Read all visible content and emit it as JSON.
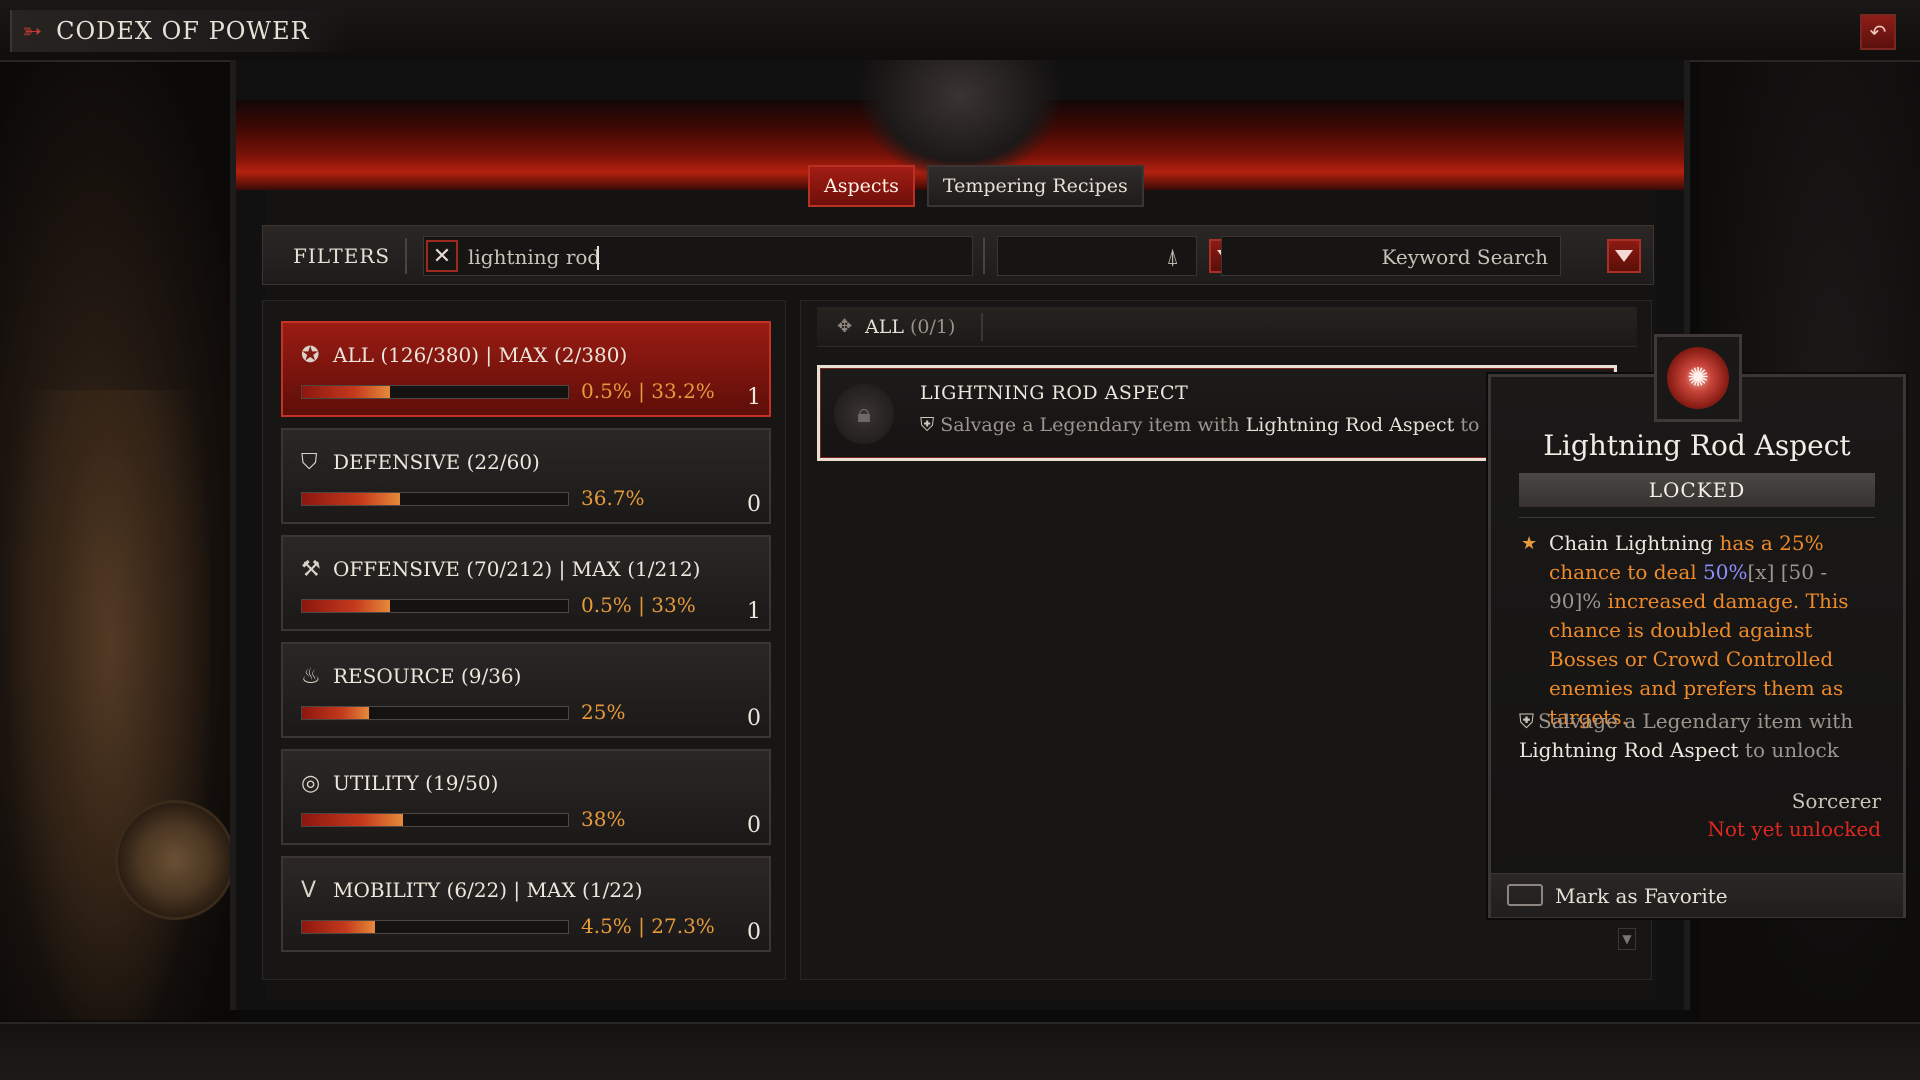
{
  "header": {
    "title": "CODEX OF POWER",
    "back_icon": "return-arrow-icon"
  },
  "tabs": [
    {
      "label": "Aspects",
      "active": true
    },
    {
      "label": "Tempering Recipes",
      "active": false
    }
  ],
  "filters": {
    "label": "FILTERS",
    "search_value": "lightning rod",
    "keyword_placeholder": "Keyword Search"
  },
  "categories": [
    {
      "icon": "star-icon",
      "label": "ALL (126/380) | MAX (2/380)",
      "pct_text": "0.5% | 33.2%",
      "count": "1",
      "progress": 0.33,
      "active": true
    },
    {
      "icon": "shield-icon",
      "label": "DEFENSIVE (22/60)",
      "pct_text": "36.7%",
      "count": "0",
      "progress": 0.367,
      "active": false
    },
    {
      "icon": "axe-icon",
      "label": "OFFENSIVE (70/212) | MAX (1/212)",
      "pct_text": "0.5% | 33%",
      "count": "1",
      "progress": 0.33,
      "active": false
    },
    {
      "icon": "flame-icon",
      "label": "RESOURCE (9/36)",
      "pct_text": "25%",
      "count": "0",
      "progress": 0.25,
      "active": false
    },
    {
      "icon": "swirl-icon",
      "label": "UTILITY (19/50)",
      "pct_text": "38%",
      "count": "0",
      "progress": 0.38,
      "active": false
    },
    {
      "icon": "wings-icon",
      "label": "MOBILITY (6/22) | MAX (1/22)",
      "pct_text": "4.5% | 27.3%",
      "count": "0",
      "progress": 0.273,
      "active": false
    }
  ],
  "list": {
    "header_label": "ALL",
    "header_count": "(0/1)",
    "items": [
      {
        "name": "LIGHTNING ROD ASPECT",
        "desc_prefix": "Salvage a Legendary item with ",
        "desc_highlight": "Lightning Rod Aspect",
        "desc_suffix": " to u"
      }
    ]
  },
  "tooltip": {
    "title": "Lightning Rod Aspect",
    "state": "LOCKED",
    "effect": {
      "skill": "Chain Lightning",
      "part1": " has a 25% chance to deal ",
      "value": "50%",
      "mult": "[x]",
      "range": " [50 - 90]%",
      "part2": " increased damage. This chance is doubled against Bosses or Crowd Controlled enemies and prefers them as targets."
    },
    "unlock_prefix": "Salvage a Legendary item with ",
    "unlock_highlight": "Lightning Rod Aspect",
    "unlock_suffix": " to unlock",
    "class": "Sorcerer",
    "status": "Not yet unlocked",
    "favorite_label": "Mark as Favorite"
  },
  "colors": {
    "accent_red": "#a31d14",
    "percent_orange": "#e79a3b",
    "effect_orange": "#ee8a2a",
    "value_blue": "#8d8fff",
    "status_red": "#e0271f"
  }
}
